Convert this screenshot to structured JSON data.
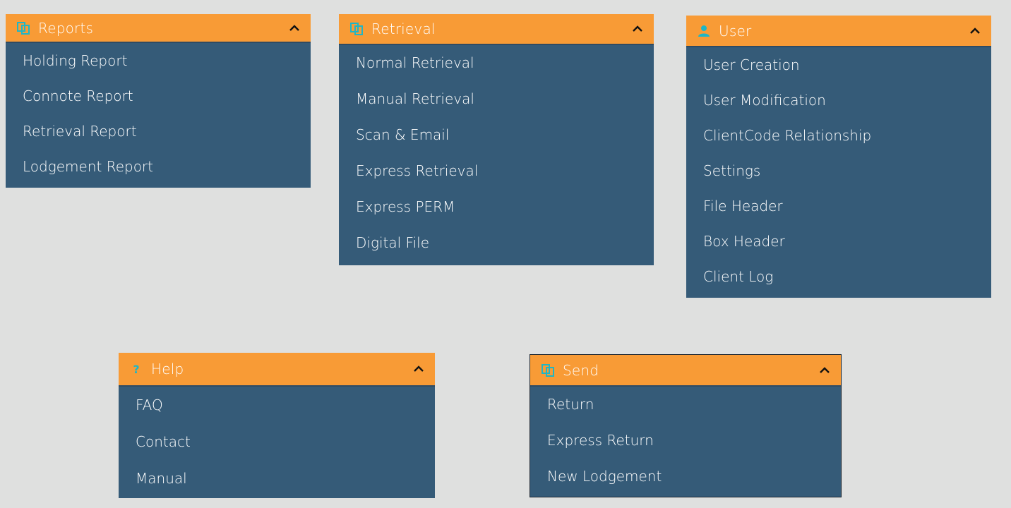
{
  "panels": {
    "reports": {
      "title": "Reports",
      "icon": "copy-icon",
      "items": [
        "Holding Report",
        "Connote Report",
        "Retrieval Report",
        "Lodgement Report"
      ]
    },
    "retrieval": {
      "title": "Retrieval",
      "icon": "copy-icon",
      "items": [
        "Normal Retrieval",
        "Manual Retrieval",
        "Scan & Email",
        "Express Retrieval",
        "Express PERM",
        "Digital File"
      ]
    },
    "user": {
      "title": "User",
      "icon": "user-icon",
      "items": [
        "User Creation",
        "User Modification",
        "ClientCode Relationship",
        "Settings",
        "File Header",
        "Box Header",
        "Client Log"
      ]
    },
    "help": {
      "title": "Help",
      "icon": "question-icon",
      "items": [
        "FAQ",
        "Contact",
        "Manual"
      ]
    },
    "send": {
      "title": "Send",
      "icon": "copy-icon",
      "items": [
        "Return",
        "Express Return",
        "New Lodgement"
      ]
    }
  },
  "colors": {
    "header_bg": "#f89b36",
    "panel_bg": "#355b78",
    "icon_accent": "#1fb6c6",
    "page_bg": "#dfe0df"
  }
}
